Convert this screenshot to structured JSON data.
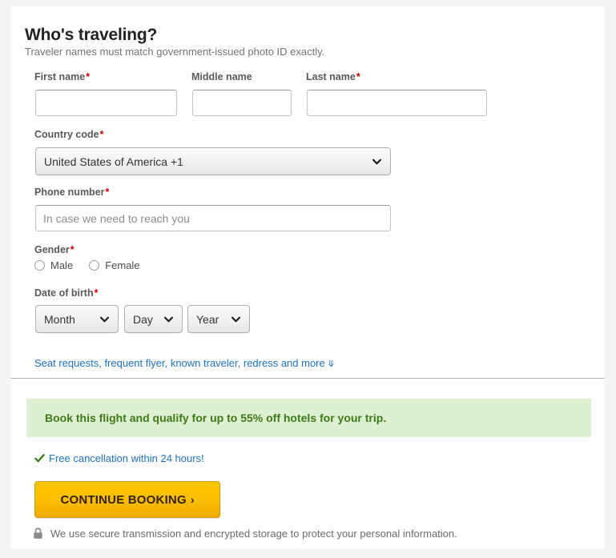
{
  "traveler": {
    "title": "Who's traveling?",
    "subtitle": "Traveler names must match government-issued photo ID exactly.",
    "first_name": {
      "label": "First name",
      "required_mark": "*",
      "value": "",
      "placeholder": ""
    },
    "middle_name": {
      "label": "Middle name",
      "required_mark": "",
      "value": "",
      "placeholder": ""
    },
    "last_name": {
      "label": "Last name",
      "required_mark": "*",
      "value": "",
      "placeholder": ""
    },
    "country_code": {
      "label": "Country code",
      "required_mark": "*",
      "selected": "United States of America +1",
      "icon": "chevron-down-icon"
    },
    "phone": {
      "label": "Phone number",
      "required_mark": "*",
      "value": "",
      "placeholder": "In case we need to reach you"
    },
    "gender": {
      "label": "Gender",
      "required_mark": "*",
      "options": [
        {
          "label": "Male",
          "selected": false
        },
        {
          "label": "Female",
          "selected": false
        }
      ]
    },
    "dob": {
      "label": "Date of birth",
      "required_mark": "*",
      "month": {
        "selected": "Month",
        "icon": "chevron-down-icon"
      },
      "day": {
        "selected": "Day",
        "icon": "chevron-down-icon"
      },
      "year": {
        "selected": "Year",
        "icon": "chevron-down-icon"
      }
    },
    "expand_link": {
      "label": "Seat requests, frequent flyer, known traveler, redress and more",
      "icon": "double-chevron-down-icon"
    }
  },
  "promo": {
    "banner_text": "Book this flight and qualify for up to 55% off hotels for your trip.",
    "cancellation": {
      "icon": "check-icon",
      "label": "Free cancellation within 24 hours!"
    }
  },
  "actions": {
    "continue": {
      "label": "CONTINUE BOOKING",
      "arrow": "›",
      "icon": "chevron-right-icon"
    },
    "secure_note": {
      "icon": "lock-icon",
      "label": "We use secure transmission and encrypted storage to protect your personal information."
    }
  },
  "colors": {
    "page_bg": "#f4f4f4",
    "card_bg": "#ffffff",
    "required_red": "#cc0000",
    "link_blue": "#1a73c4",
    "promo_bg": "#ddf0d3",
    "promo_text": "#3d7a14",
    "cta_yellow": "#fcc000",
    "check_green": "#2e7d14"
  }
}
